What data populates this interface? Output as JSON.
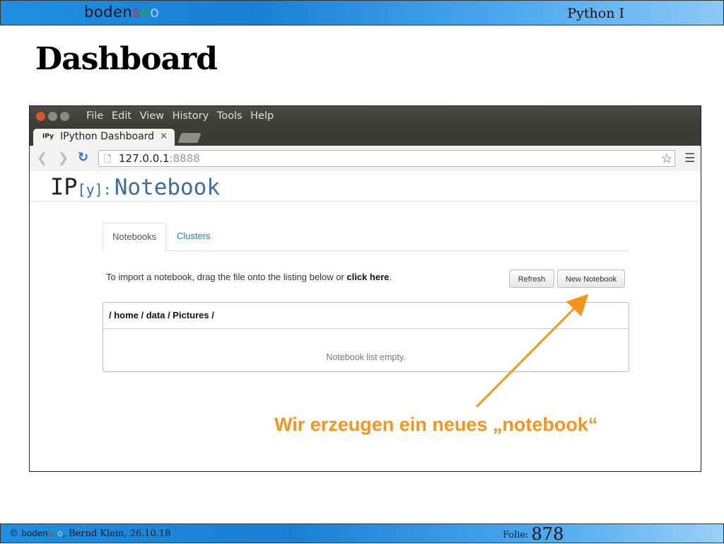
{
  "slide": {
    "brand": {
      "p1": "boden",
      "p2": "s",
      "p3": "e",
      "p4": "o"
    },
    "course": "Python I",
    "title": "Dashboard",
    "callout": "Wir erzeugen ein neues „notebook“",
    "footer": {
      "copyright_symbol": "©",
      "author_text": ", Bernd Klein, 26.10.18",
      "folio_label": "Folie:",
      "folio_number": "878"
    }
  },
  "browser": {
    "menu": [
      "File",
      "Edit",
      "View",
      "History",
      "Tools",
      "Help"
    ],
    "tab": {
      "favicon": "IPy",
      "title": "IPython Dashboard",
      "close": "×"
    },
    "url": {
      "host": "127.0.0.1",
      "port": ":8888"
    }
  },
  "notebook": {
    "logo": {
      "ip": "IP",
      "y": "[y]:",
      "name": "Notebook"
    },
    "tabs": [
      "Notebooks",
      "Clusters"
    ],
    "import_prefix": "To import a notebook, drag the file onto the listing below or ",
    "import_link": "click here",
    "import_suffix": ".",
    "buttons": {
      "refresh": "Refresh",
      "new": "New Notebook"
    },
    "breadcrumb": "/ home / data / Pictures /",
    "empty_message": "Notebook list empty."
  },
  "icons": [
    "close-icon",
    "minimize-icon",
    "maximize-icon",
    "back-icon",
    "forward-icon",
    "reload-icon",
    "page-icon",
    "star-icon",
    "menu-icon"
  ],
  "colors": {
    "accent": "#f7941d",
    "link": "#1a84c6",
    "header_bar": "#1f8fe0"
  }
}
